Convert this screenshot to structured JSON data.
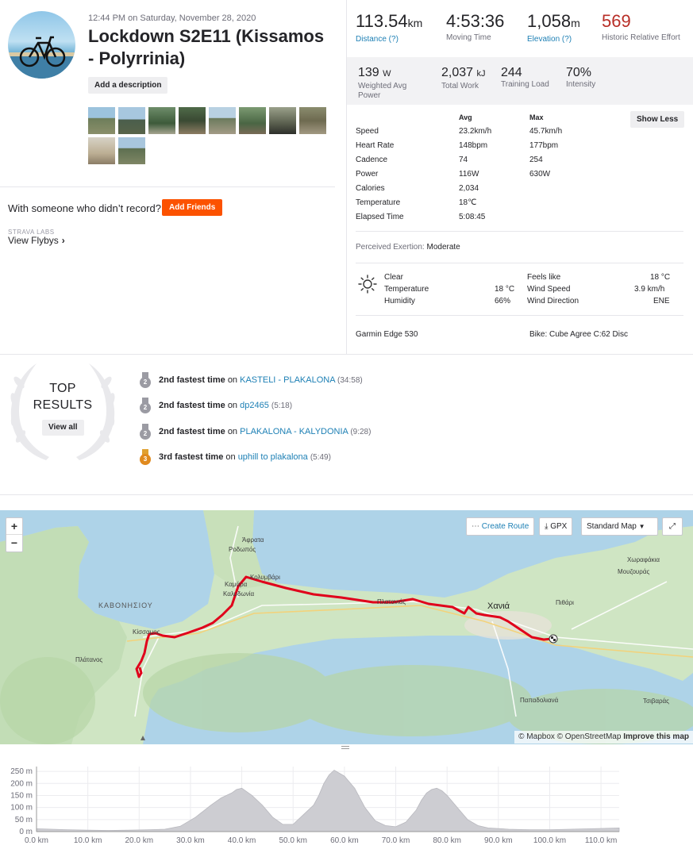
{
  "activity": {
    "date": "12:44 PM on Saturday, November 28, 2020",
    "title": "Lockdown S2E11 (Kissamos - Polyrrinia)",
    "add_description": "Add a description",
    "photo_count": 10,
    "with_someone": "With someone who didn’t record?",
    "add_friends": "Add Friends",
    "labs": "STRAVA LABS",
    "view_flybys": "View Flybys"
  },
  "primary_stats": [
    {
      "value": "113.54",
      "unit": "km",
      "label": "Distance (?)",
      "link": true
    },
    {
      "value": "4:53:36",
      "unit": "",
      "label": "Moving Time",
      "link": false
    },
    {
      "value": "1,058",
      "unit": "m",
      "label": "Elevation (?)",
      "link": true
    },
    {
      "value": "569",
      "unit": "",
      "label": "Historic Relative Effort",
      "link": false
    }
  ],
  "secondary_stats": [
    {
      "value": "139",
      "unit": "W",
      "label": "Weighted Avg Power"
    },
    {
      "value": "2,037",
      "unit": "kJ",
      "label": "Total Work"
    },
    {
      "value": "244",
      "unit": "",
      "label": "Training Load"
    },
    {
      "value": "70%",
      "unit": "",
      "label": "Intensity"
    }
  ],
  "detail_table": {
    "avg_header": "Avg",
    "max_header": "Max",
    "show_less": "Show Less",
    "rows": [
      {
        "label": "Speed",
        "avg": "23.2km/h",
        "max": "45.7km/h"
      },
      {
        "label": "Heart Rate",
        "avg": "148bpm",
        "max": "177bpm"
      },
      {
        "label": "Cadence",
        "avg": "74",
        "max": "254"
      },
      {
        "label": "Power",
        "avg": "116W",
        "max": "630W"
      },
      {
        "label": "Calories",
        "avg": "2,034",
        "max": ""
      },
      {
        "label": "Temperature",
        "avg": "18℃",
        "max": ""
      },
      {
        "label": "Elapsed Time",
        "avg": "5:08:45",
        "max": ""
      }
    ]
  },
  "exertion": {
    "label": "Perceived Exertion:",
    "value": "Moderate"
  },
  "weather": {
    "condition": "Clear",
    "temperature_label": "Temperature",
    "temperature": "18 °C",
    "humidity_label": "Humidity",
    "humidity": "66%",
    "feels_like_label": "Feels like",
    "feels_like": "18 °C",
    "wind_speed_label": "Wind Speed",
    "wind_speed": "3.9 km/h",
    "wind_direction_label": "Wind Direction",
    "wind_direction": "ENE"
  },
  "gear": {
    "device": "Garmin Edge 530",
    "bike": "Bike: Cube Agree C:62 Disc"
  },
  "top_results": {
    "title_line1": "TOP",
    "title_line2": "RESULTS",
    "view_all": "View all",
    "items": [
      {
        "rank": "2",
        "medal": "silver",
        "text": "2nd fastest time",
        "on": "on",
        "segment": "KASTELI - PLAKALONA",
        "time": "(34:58)"
      },
      {
        "rank": "2",
        "medal": "silver",
        "text": "2nd fastest time",
        "on": "on",
        "segment": "dp2465",
        "time": "(5:18)"
      },
      {
        "rank": "2",
        "medal": "silver",
        "text": "2nd fastest time",
        "on": "on",
        "segment": "PLAKALONA - KALYDONIA",
        "time": "(9:28)"
      },
      {
        "rank": "3",
        "medal": "bronze",
        "text": "3rd fastest time",
        "on": "on",
        "segment": "uphill to plakalona",
        "time": "(5:49)"
      }
    ]
  },
  "map": {
    "zoom_in": "+",
    "zoom_out": "−",
    "create_route": "Create Route",
    "gpx": "GPX",
    "map_style": "Standard Map",
    "attribution_a": "© Mapbox © OpenStreetMap",
    "attribution_b": "Improve this map",
    "labels": {
      "afrata": "Άφρατα",
      "rodopos": "Ροδωπός",
      "kolymvari": "Κολυμβάρι",
      "kamara": "Καμάρα",
      "kalydonia": "Καλυδωνία",
      "kavonisiou": "ΚΑΒΟΝΗΣΙΟΥ",
      "kissamos": "Κίσσαμος",
      "platanos": "Πλάτανος",
      "platanias": "Πλατανιάς",
      "chania": "Χανιά",
      "pithari": "Πιθάρι",
      "chorafakia": "Χωραφάκια",
      "mouzouras": "Μουζουράς",
      "pattadoliana": "Παπαδολιανά",
      "tsivaras": "Τσιβαράς"
    },
    "colors": {
      "route": "#e0001b",
      "water": "#aed3e8",
      "land": "#cfe5c3"
    }
  },
  "elevation_profile": {
    "y_ticks": [
      "0 m",
      "50 m",
      "100 m",
      "150 m",
      "200 m",
      "250 m"
    ],
    "x_ticks": [
      "0.0 km",
      "10.0 km",
      "20.0 km",
      "30.0 km",
      "40.0 km",
      "50.0 km",
      "60.0 km",
      "70.0 km",
      "80.0 km",
      "90.0 km",
      "100.0 km",
      "110.0 km"
    ],
    "ylim": [
      0,
      270
    ],
    "xlim": [
      0,
      113.54
    ],
    "x_km": [
      0,
      3,
      6,
      10,
      14,
      18,
      22,
      25,
      28,
      31,
      34,
      36,
      38,
      39,
      40,
      42,
      44,
      46,
      48,
      50,
      52,
      54,
      55,
      56,
      57,
      58,
      60,
      62,
      64,
      66,
      68,
      70,
      72,
      74,
      75,
      76,
      77,
      78,
      79,
      80,
      82,
      84,
      86,
      88,
      92,
      96,
      100,
      104,
      108,
      113.54
    ],
    "y_m": [
      12,
      10,
      8,
      6,
      5,
      6,
      8,
      10,
      22,
      60,
      110,
      140,
      160,
      175,
      180,
      150,
      110,
      60,
      30,
      30,
      70,
      110,
      150,
      200,
      235,
      255,
      230,
      180,
      100,
      45,
      25,
      20,
      40,
      90,
      130,
      160,
      175,
      180,
      170,
      150,
      100,
      50,
      25,
      15,
      10,
      8,
      8,
      10,
      12,
      15
    ]
  }
}
